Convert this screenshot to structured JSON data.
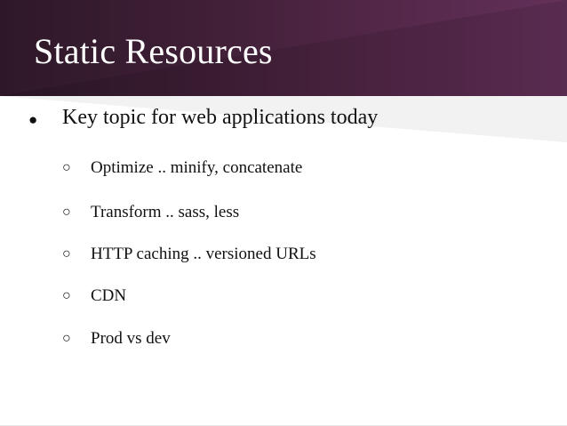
{
  "slide": {
    "title": "Static Resources",
    "bullets": [
      {
        "marker": "●",
        "text": "Key topic for web applications today",
        "subitems": [
          {
            "marker": "○",
            "text": "Optimize .. minify, concatenate"
          },
          {
            "marker": "○",
            "text": "Transform .. sass, less"
          },
          {
            "marker": "○",
            "text": "HTTP caching .. versioned URLs"
          },
          {
            "marker": "○",
            "text": "CDN"
          },
          {
            "marker": "○",
            "text": "Prod vs dev"
          }
        ]
      }
    ]
  },
  "colors": {
    "header_dark": "#2e1828",
    "header_light": "#63305a",
    "background": "#ffffff",
    "text": "#111111"
  }
}
